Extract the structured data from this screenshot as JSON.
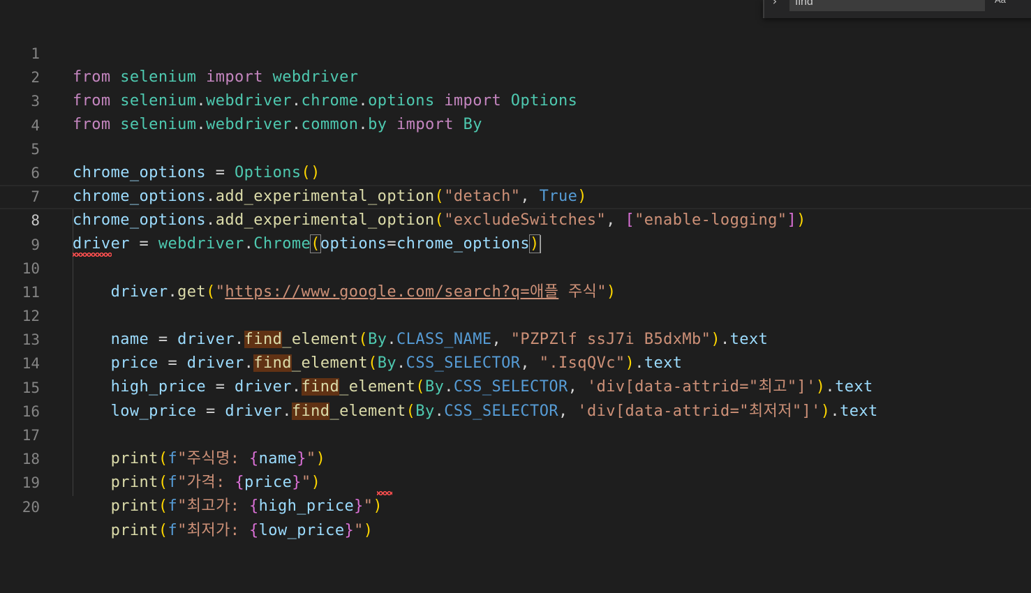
{
  "find_widget": {
    "query": "find",
    "toggle_icon": "chevron-right-icon",
    "match_case_label": "Aa"
  },
  "editor": {
    "current_line": 8,
    "lines": [
      {
        "n": "1"
      },
      {
        "n": "2"
      },
      {
        "n": "3"
      },
      {
        "n": "4"
      },
      {
        "n": "5"
      },
      {
        "n": "6"
      },
      {
        "n": "7"
      },
      {
        "n": "8"
      },
      {
        "n": "9"
      },
      {
        "n": "10"
      },
      {
        "n": "11"
      },
      {
        "n": "12"
      },
      {
        "n": "13"
      },
      {
        "n": "14"
      },
      {
        "n": "15"
      },
      {
        "n": "16"
      },
      {
        "n": "17"
      },
      {
        "n": "18"
      },
      {
        "n": "19"
      },
      {
        "n": "20"
      }
    ],
    "tokens": {
      "from": "from",
      "import": "import",
      "selenium": "selenium",
      "webdriver": "webdriver",
      "chrome": "chrome",
      "options": "options",
      "Options": "Options",
      "common": "common",
      "by": "by",
      "By": "By",
      "chrome_options": "chrome_options",
      "add_experimental_option": "add_experimental_option",
      "detach": "\"detach\"",
      "True": "True",
      "excludeSwitches": "\"excludeSwitches\"",
      "enable_logging": "\"enable-logging\"",
      "driver": "driver",
      "Chrome": "Chrome",
      "options_kw": "options",
      "get": "get",
      "q_open": "\"",
      "url": "https://www.google.com/search?q=애플",
      "url_tail": " 주식\"",
      "name": "name",
      "price": "price",
      "high_price": "high_price",
      "low_price": "low_price",
      "find": "find",
      "_element": "_element",
      "CLASS_NAME": "CLASS_NAME",
      "CSS_SELECTOR": "CSS_SELECTOR",
      "class_str": "\"PZPZlf ssJ7i B5dxMb\"",
      "css_str": "\".IsqQVc\"",
      "high_sel": "'div[data-attrid=\"최고\"]'",
      "low_sel": "'div[data-attrid=\"최저저\"]'",
      "text": "text",
      "print": "print",
      "f": "f",
      "fs1": "\"주식명: ",
      "fs2": "\"가격: ",
      "fs3": "\"최고가: ",
      "fs4": "\"최저가: ",
      "dq": "\""
    }
  }
}
